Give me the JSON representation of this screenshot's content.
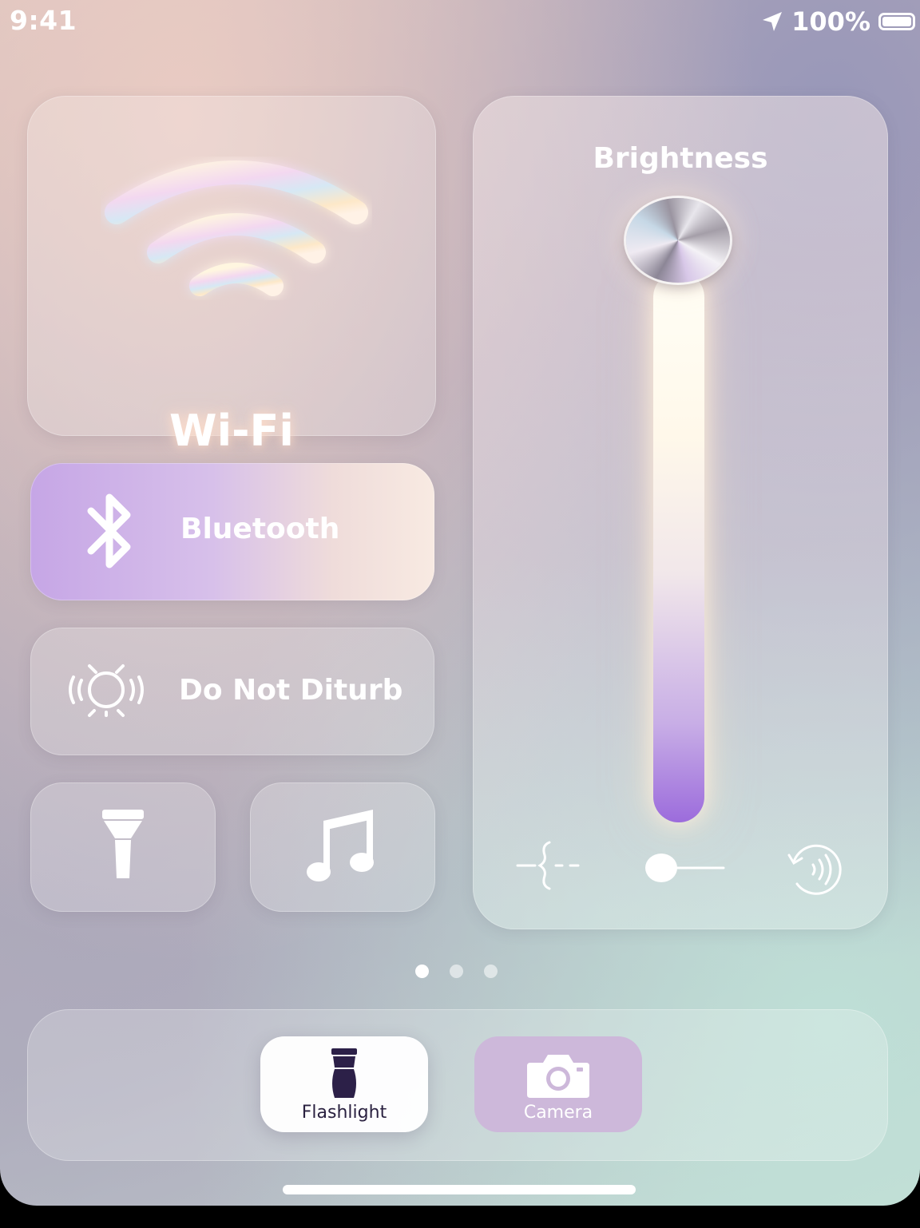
{
  "status_bar": {
    "time": "9:41",
    "battery_percent": "100%",
    "icons": [
      "location-arrow-icon",
      "battery-icon"
    ]
  },
  "tiles": {
    "wifi": {
      "label": "Wi-Fi",
      "icon": "wifi-icon"
    },
    "bluetooth": {
      "label": "Bluetooth",
      "icon": "bluetooth-icon",
      "accent": "#c6a6e6"
    },
    "do_not_disturb": {
      "label": "Do Not Diturb",
      "icon": "alarm-ring-icon"
    },
    "flashlight_small": {
      "icon": "flashlight-icon"
    },
    "music": {
      "icon": "music-note-icon"
    }
  },
  "brightness": {
    "label": "Brightness",
    "level": 1.0,
    "bottom_icons": [
      "connector-icon",
      "toggle-slider-icon",
      "rotate-sound-icon"
    ]
  },
  "page_dots": {
    "count": 3,
    "active_index": 0
  },
  "dock": {
    "flashlight": {
      "label": "Flashlight",
      "icon": "flashlight-icon"
    },
    "camera": {
      "label": "Camera",
      "icon": "camera-icon",
      "accent": "#cdb8da"
    }
  }
}
